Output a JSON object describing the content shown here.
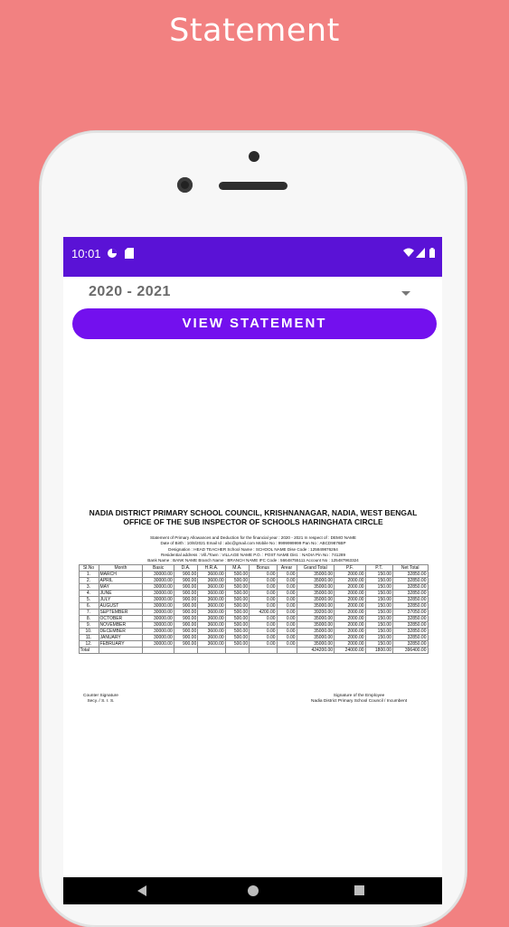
{
  "page": {
    "title": "Statement"
  },
  "status_bar": {
    "time": "10:01"
  },
  "selector": {
    "year": "2020 - 2021"
  },
  "actions": {
    "view_statement": "VIEW STATEMENT"
  },
  "statement": {
    "council": "NADIA DISTRICT PRIMARY SCHOOL COUNCIL, KRISHNANAGAR, NADIA, WEST BENGAL",
    "office": "OFFICE OF THE SUB INSPECTOR OF SCHOOLS HARINGHATA CIRCLE",
    "line1": "Statement of Primary Allowances and Deduction for the financial year :  2020 - 2021   In respect of :   DEMO NAME",
    "line2": "Date of Birth :  10/8/2021   Email Id :  abc@gmail.com    Mobile No :  9999999999   Pan No :  ABCD9876BP",
    "line3": "Designation :   HEAD TEACHER     School Name :    SCHOOL NAME      Dise Code :    125849876264",
    "line4": "Residential address :  Vill./Town :      VILLAGE NAME       P.O. :      POST NAME        Dist. :     NADIA      Pin No :    741289",
    "line5": "Bank Name :  BANK NAME  Branch Name :  BRANCH NAME  IFC Code :  56648755111   Account No :  125487963324",
    "columns": [
      "Sl.No",
      "Month",
      "Basic",
      "D.A.",
      "H.R.A.",
      "M.A.",
      "Bonus",
      "Arear",
      "Grand Total",
      "P.F.",
      "P.T.",
      "Net Total"
    ],
    "rows": [
      [
        "1.",
        "MARCH",
        "30000.00",
        "900.00",
        "3600.00",
        "500.00",
        "0.00",
        "0.00",
        "35000.00",
        "2000.00",
        "150.00",
        "32850.00"
      ],
      [
        "2.",
        "APRIL",
        "30000.00",
        "900.00",
        "3600.00",
        "500.00",
        "0.00",
        "0.00",
        "35000.00",
        "2000.00",
        "150.00",
        "32850.00"
      ],
      [
        "3.",
        "MAY",
        "30000.00",
        "900.00",
        "3600.00",
        "500.00",
        "0.00",
        "0.00",
        "35000.00",
        "2000.00",
        "150.00",
        "32850.00"
      ],
      [
        "4.",
        "JUNE",
        "30000.00",
        "900.00",
        "3600.00",
        "500.00",
        "0.00",
        "0.00",
        "35000.00",
        "2000.00",
        "150.00",
        "32850.00"
      ],
      [
        "5.",
        "JULY",
        "30000.00",
        "900.00",
        "3600.00",
        "500.00",
        "0.00",
        "0.00",
        "35000.00",
        "2000.00",
        "150.00",
        "32850.00"
      ],
      [
        "6.",
        "AUGUST",
        "30000.00",
        "900.00",
        "3600.00",
        "500.00",
        "0.00",
        "0.00",
        "35000.00",
        "2000.00",
        "150.00",
        "32850.00"
      ],
      [
        "7.",
        "SEPTEMBER",
        "30000.00",
        "900.00",
        "3600.00",
        "500.00",
        "4200.00",
        "0.00",
        "39200.00",
        "2000.00",
        "150.00",
        "37050.00"
      ],
      [
        "8.",
        "OCTOBER",
        "30000.00",
        "900.00",
        "3600.00",
        "500.00",
        "0.00",
        "0.00",
        "35000.00",
        "2000.00",
        "150.00",
        "32850.00"
      ],
      [
        "9.",
        "NOVEMBER",
        "30000.00",
        "900.00",
        "3600.00",
        "500.00",
        "0.00",
        "0.00",
        "35000.00",
        "2000.00",
        "150.00",
        "32850.00"
      ],
      [
        "10.",
        "DECEMBER",
        "30000.00",
        "900.00",
        "3600.00",
        "500.00",
        "0.00",
        "0.00",
        "35000.00",
        "2000.00",
        "150.00",
        "32850.00"
      ],
      [
        "11.",
        "JANUARY",
        "30000.00",
        "900.00",
        "3600.00",
        "500.00",
        "0.00",
        "0.00",
        "35000.00",
        "2000.00",
        "150.00",
        "32850.00"
      ],
      [
        "12.",
        "FEBRUARY",
        "30000.00",
        "900.00",
        "3600.00",
        "500.00",
        "0.00",
        "0.00",
        "35000.00",
        "2000.00",
        "150.00",
        "32850.00"
      ]
    ],
    "total": {
      "label": "Total",
      "grand_total": "424200.00",
      "pf": "24000.00",
      "pt": "1800.00",
      "net_total": "396400.00"
    },
    "sig_left_1": "Counter Signature",
    "sig_left_2": "Secy. / S. I. S.",
    "sig_right_1": "Signature of the Employee",
    "sig_right_2": "Nadia District Primary School Council / Incumbent"
  }
}
